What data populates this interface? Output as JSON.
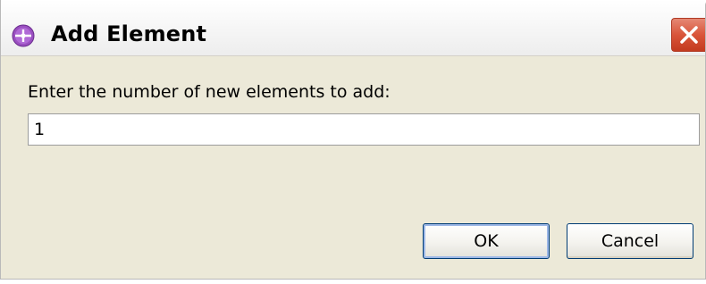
{
  "window": {
    "title": "Add Element",
    "icon": "element-add-icon",
    "close_icon": "close-icon",
    "accent_color": "#9a4fc0",
    "close_color": "#d9553a"
  },
  "content": {
    "prompt": "Enter the number of new elements to add:",
    "count_value": "1"
  },
  "buttons": {
    "ok_label": "OK",
    "cancel_label": "Cancel"
  }
}
